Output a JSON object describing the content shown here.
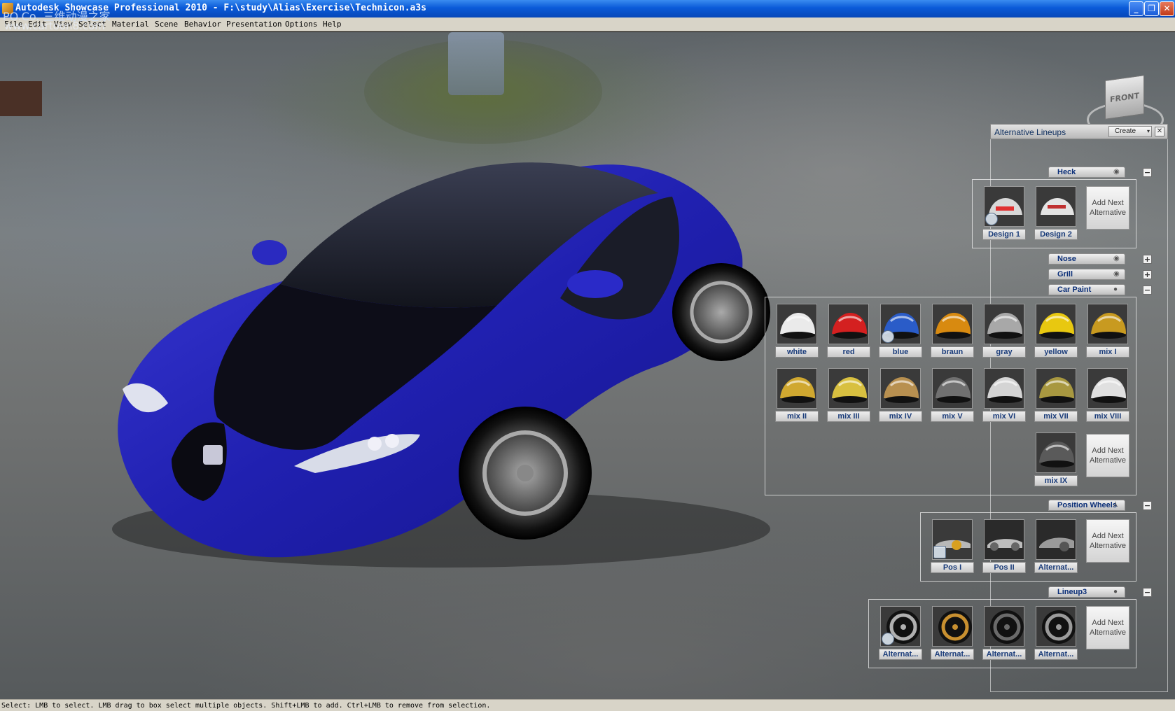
{
  "window": {
    "title": "Autodesk Showcase Professional 2010 - F:\\study\\Alias\\Exercise\\Technicon.a3s",
    "minimize": "_",
    "restore": "❐",
    "close": "✕"
  },
  "watermark": {
    "line1": "PO.Co. 三维动漫之家",
    "line2": "www.cartoon8.com"
  },
  "menu": [
    "File",
    "Edit",
    "View",
    "Select",
    "Material",
    "Scene",
    "Behavior",
    "Presentation",
    "Options",
    "Help"
  ],
  "viewcube": {
    "label": "FRONT"
  },
  "alt_lineups": {
    "title": "Alternative Lineups",
    "create_label": "Create",
    "dropdown_arrow": "▾",
    "close_label": "✕",
    "add_next": "Add Next Alternative",
    "groups": {
      "heck": {
        "name": "Heck",
        "toggle": "−",
        "icon": "eye-icon",
        "items": [
          {
            "label": "Design 1",
            "color": "#c9c9c9",
            "accent": "#e83c3c"
          },
          {
            "label": "Design 2",
            "color": "#d8d8d8",
            "accent": "#c83030"
          }
        ]
      },
      "nose": {
        "name": "Nose",
        "toggle": "+",
        "icon": "eye-icon"
      },
      "grill": {
        "name": "Grill",
        "toggle": "+",
        "icon": "eye-icon"
      },
      "car_paint": {
        "name": "Car Paint",
        "toggle": "−",
        "icon": "sphere-icon",
        "items": [
          {
            "label": "white",
            "color": "#eaeaea"
          },
          {
            "label": "red",
            "color": "#d42020"
          },
          {
            "label": "blue",
            "color": "#2a5cc8"
          },
          {
            "label": "braun",
            "color": "#d88a10"
          },
          {
            "label": "gray",
            "color": "#a8a8a8"
          },
          {
            "label": "yellow",
            "color": "#e8c810"
          },
          {
            "label": "mix I",
            "color": "#c89a20"
          },
          {
            "label": "mix II",
            "color": "#d0a830"
          },
          {
            "label": "mix III",
            "color": "#d8c040"
          },
          {
            "label": "mix IV",
            "color": "#b89050"
          },
          {
            "label": "mix V",
            "color": "#707070"
          },
          {
            "label": "mix VI",
            "color": "#d4d4d4"
          },
          {
            "label": "mix VII",
            "color": "#a89840"
          },
          {
            "label": "mix VIII",
            "color": "#e0e0e0"
          },
          {
            "label": "mix IX",
            "color": "#5a5a5a"
          }
        ]
      },
      "position_wheels": {
        "name": "Position Wheels",
        "toggle": "−",
        "icon": "axis-icon",
        "items": [
          {
            "label": "Pos I",
            "color": "#d8a020"
          },
          {
            "label": "Pos II",
            "color": "#9a9a9a"
          },
          {
            "label": "Alternat...",
            "color": "#8a8a8a"
          }
        ]
      },
      "lineup3": {
        "name": "Lineup3",
        "toggle": "−",
        "icon": "sphere-icon",
        "items": [
          {
            "label": "Alternat...",
            "color": "#b0b0b0"
          },
          {
            "label": "Alternat...",
            "color": "#c89030"
          },
          {
            "label": "Alternat...",
            "color": "#6a6a6a"
          },
          {
            "label": "Alternat...",
            "color": "#9a9a9a"
          }
        ]
      }
    }
  },
  "status": "Select: LMB to select. LMB drag to box select multiple objects. Shift+LMB to add. Ctrl+LMB to remove from selection."
}
